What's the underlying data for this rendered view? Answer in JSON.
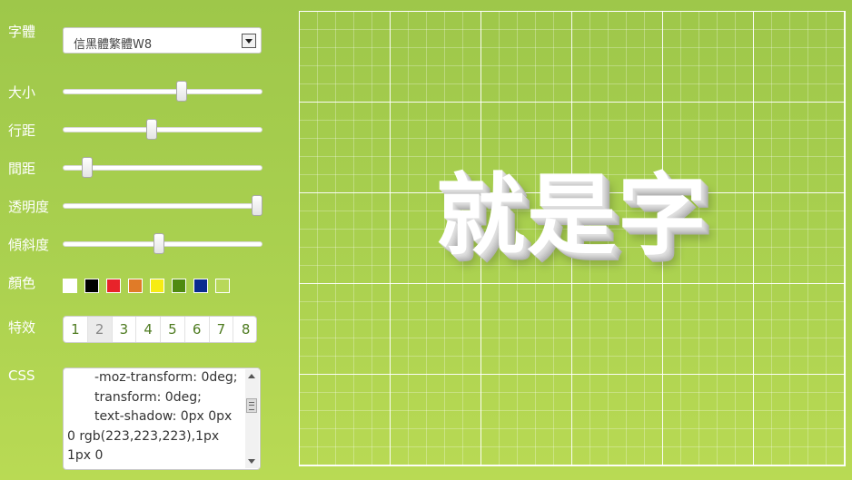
{
  "controls": {
    "font": {
      "label": "字體",
      "selected": "信黑體繁體W8"
    },
    "size": {
      "label": "大小",
      "value_fraction": 0.6
    },
    "line_height": {
      "label": "行距",
      "value_fraction": 0.44
    },
    "letter_spacing": {
      "label": "間距",
      "value_fraction": 0.1
    },
    "opacity": {
      "label": "透明度",
      "value_fraction": 1.0
    },
    "skew": {
      "label": "傾斜度",
      "value_fraction": 0.48
    },
    "color": {
      "label": "顏色",
      "swatches": [
        "#ffffff",
        "#000000",
        "#e8232a",
        "#e07b28",
        "#f7ec13",
        "#4f8a10",
        "#0a2b8f",
        "#b8d85a"
      ]
    },
    "effects": {
      "label": "特效",
      "options": [
        "1",
        "2",
        "3",
        "4",
        "5",
        "6",
        "7",
        "8"
      ],
      "selected_index": 1
    },
    "css": {
      "label": "CSS",
      "lines": [
        "-moz-transform: 0deg;",
        "transform: 0deg;",
        "text-shadow: 0px 0px",
        "0 rgb(223,223,223),1px",
        "1px 0"
      ]
    }
  },
  "preview": {
    "text": "就是字"
  }
}
